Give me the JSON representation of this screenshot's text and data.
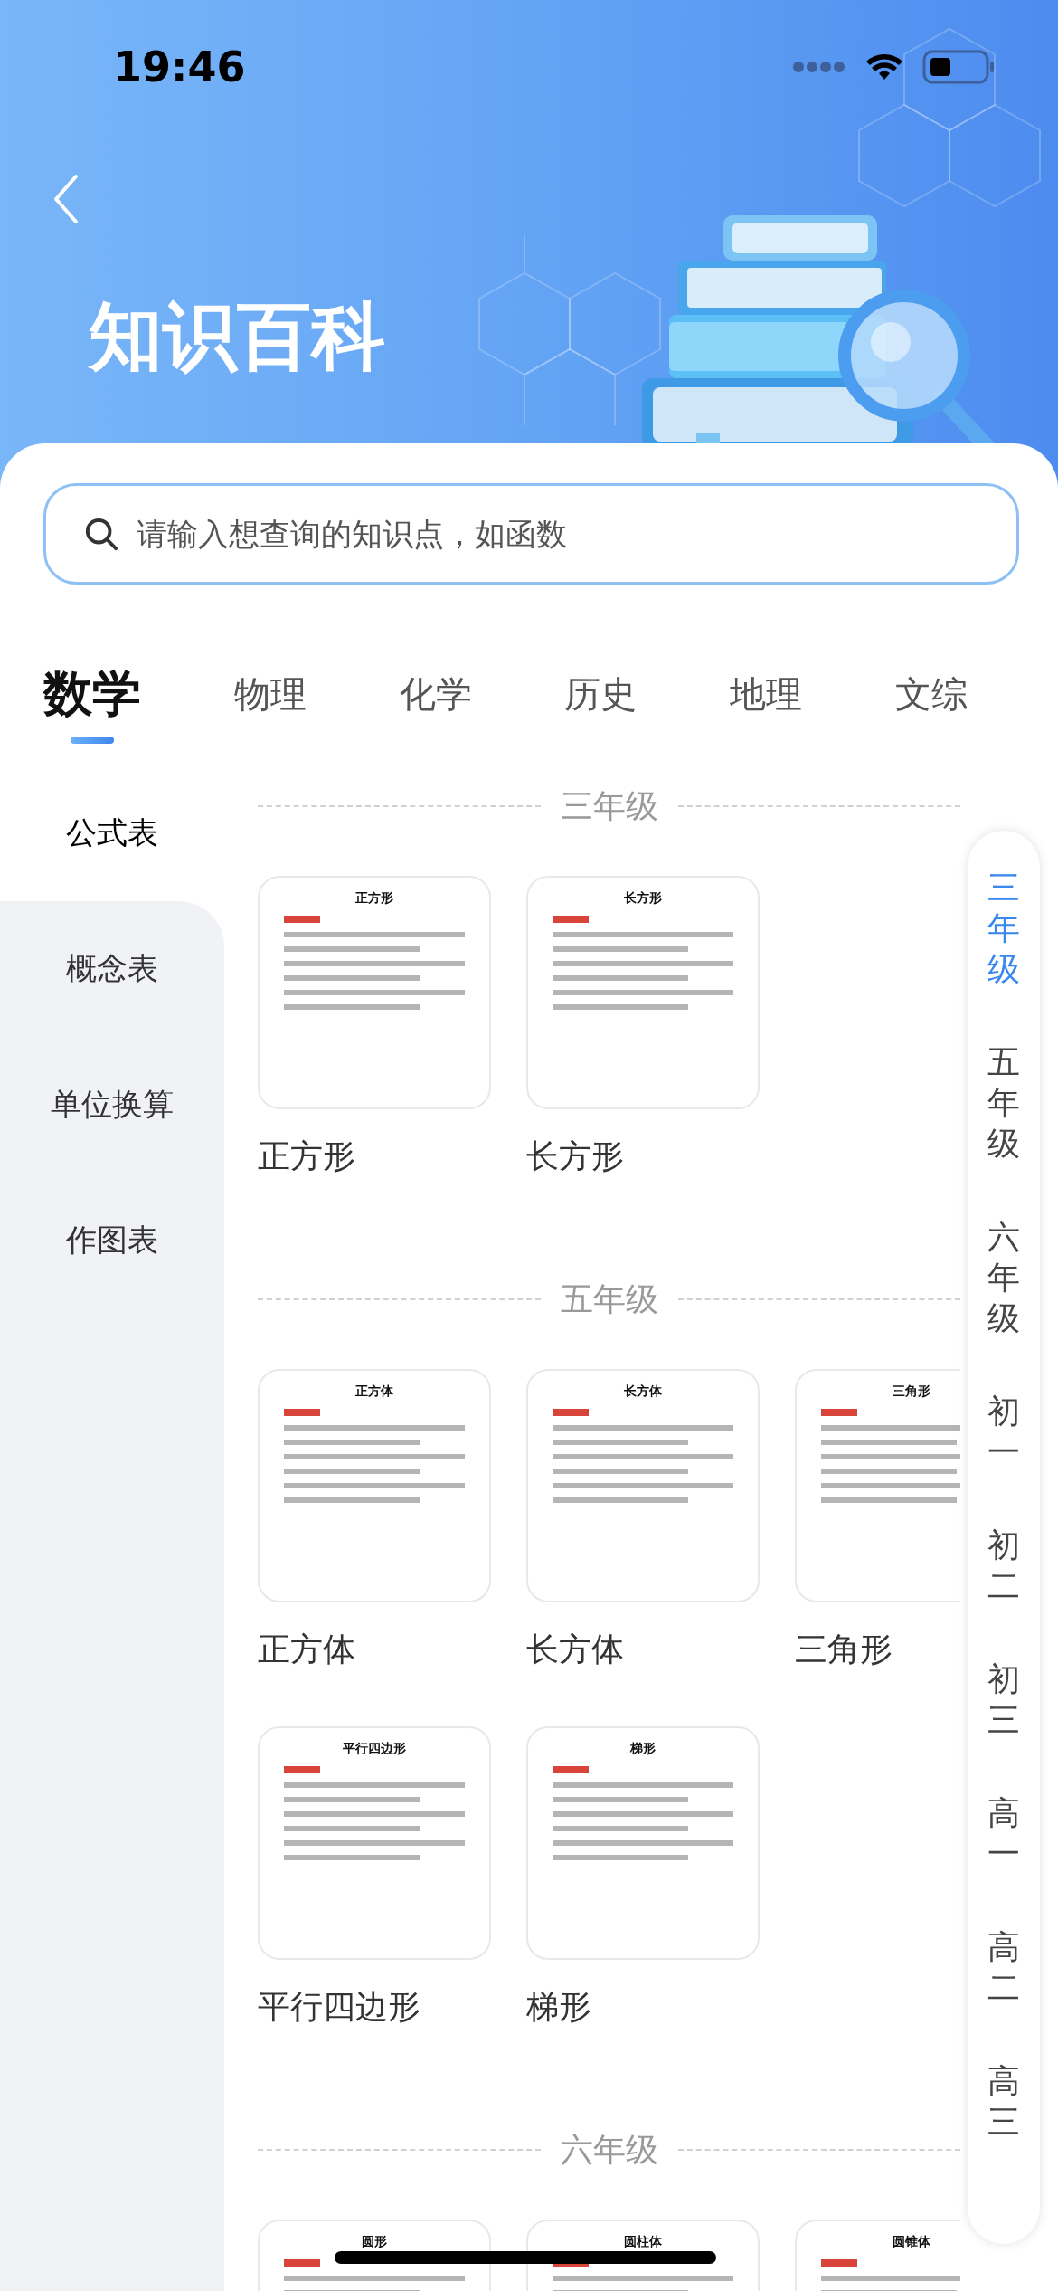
{
  "status_bar": {
    "time": "19:46"
  },
  "header": {
    "title": "知识百科"
  },
  "search": {
    "placeholder": "请输入想查询的知识点，如函数"
  },
  "subject_tabs": [
    {
      "label": "数学",
      "selected": true
    },
    {
      "label": "物理",
      "selected": false
    },
    {
      "label": "化学",
      "selected": false
    },
    {
      "label": "历史",
      "selected": false
    },
    {
      "label": "地理",
      "selected": false
    },
    {
      "label": "文综",
      "selected": false
    }
  ],
  "sidebar": {
    "items": [
      {
        "label": "公式表",
        "selected": true
      },
      {
        "label": "概念表",
        "selected": false
      },
      {
        "label": "单位换算",
        "selected": false
      },
      {
        "label": "作图表",
        "selected": false
      }
    ]
  },
  "sections": [
    {
      "heading": "三年级",
      "items": [
        {
          "preview_title": "正方形",
          "label": "正方形"
        },
        {
          "preview_title": "长方形",
          "label": "长方形"
        }
      ]
    },
    {
      "heading": "五年级",
      "items": [
        {
          "preview_title": "正方体",
          "label": "正方体"
        },
        {
          "preview_title": "长方体",
          "label": "长方体"
        },
        {
          "preview_title": "三角形",
          "label": "三角形"
        },
        {
          "preview_title": "平行四边形",
          "label": "平行四边形"
        },
        {
          "preview_title": "梯形",
          "label": "梯形"
        }
      ]
    },
    {
      "heading": "六年级",
      "items": [
        {
          "preview_title": "圆形"
        },
        {
          "preview_title": "圆柱体"
        },
        {
          "preview_title": "圆锥体"
        }
      ]
    }
  ],
  "grade_index": [
    {
      "label": "三年级",
      "selected": true
    },
    {
      "label": "五年级",
      "selected": false
    },
    {
      "label": "六年级",
      "selected": false
    },
    {
      "label": "初一",
      "selected": false
    },
    {
      "label": "初二",
      "selected": false
    },
    {
      "label": "初三",
      "selected": false
    },
    {
      "label": "高一",
      "selected": false
    },
    {
      "label": "高二",
      "selected": false
    },
    {
      "label": "高三",
      "selected": false
    }
  ]
}
